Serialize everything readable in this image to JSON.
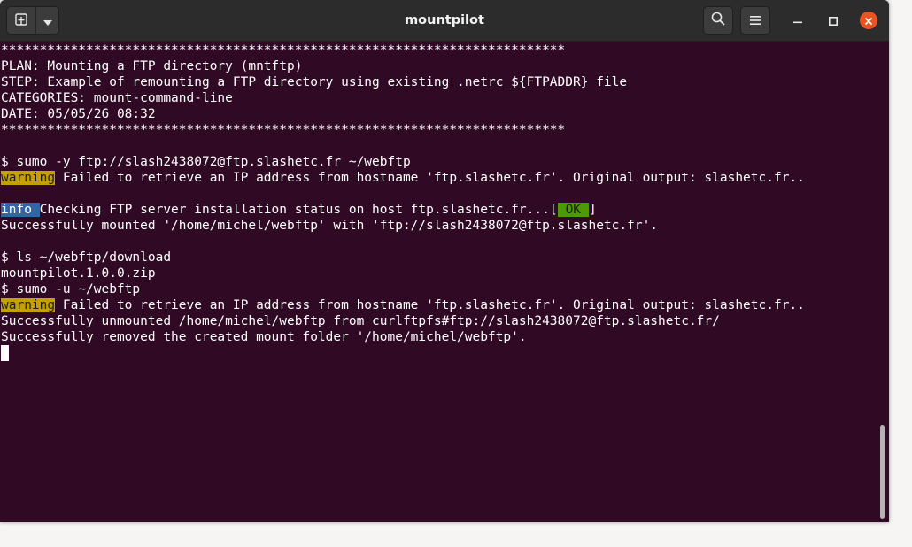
{
  "window": {
    "title": "mountpilot"
  },
  "icons": {
    "new_tab": "new-tab-icon",
    "tab_menu": "chevron-down-icon",
    "search": "search-icon",
    "menu": "hamburger-menu-icon",
    "minimize": "minimize-icon",
    "maximize": "maximize-icon",
    "close": "close-icon"
  },
  "colors": {
    "terminal_bg": "#300a24",
    "warning_bg": "#c4a000",
    "info_bg": "#3465a4",
    "ok_bg": "#4e9a06",
    "close_button": "#e95420"
  },
  "terminal": {
    "l0": "*************************************************************************",
    "l1": "PLAN: Mounting a FTP directory (mntftp)",
    "l2": "STEP: Example of remounting a FTP directory using existing .netrc_${FTPADDR} file",
    "l3": "CATEGORIES: mount-command-line",
    "l4": "DATE: 05/05/26 08:32",
    "l5": "*************************************************************************",
    "l7": "$ sumo -y ftp://slash2438072@ftp.slashetc.fr ~/webftp",
    "l8_tag": "warning",
    "l8_msg": " Failed to retrieve an IP address from hostname 'ftp.slashetc.fr'. Original output: slashetc.fr..",
    "l10_tag": "info ",
    "l10_msg": "Checking FTP server installation status on host ftp.slashetc.fr...[",
    "l10_ok": "OK",
    "l10_end": "]",
    "l11": "Successfully mounted '/home/michel/webftp' with 'ftp://slash2438072@ftp.slashetc.fr'.",
    "l13": "$ ls ~/webftp/download",
    "l14": "mountpilot.1.0.0.zip",
    "l15": "$ sumo -u ~/webftp",
    "l16_tag": "warning",
    "l16_msg": " Failed to retrieve an IP address from hostname 'ftp.slashetc.fr'. Original output: slashetc.fr..",
    "l17": "Successfully unmounted /home/michel/webftp from curlftpfs#ftp://slash2438072@ftp.slashetc.fr/",
    "l18": "Successfully removed the created mount folder '/home/michel/webftp'."
  }
}
